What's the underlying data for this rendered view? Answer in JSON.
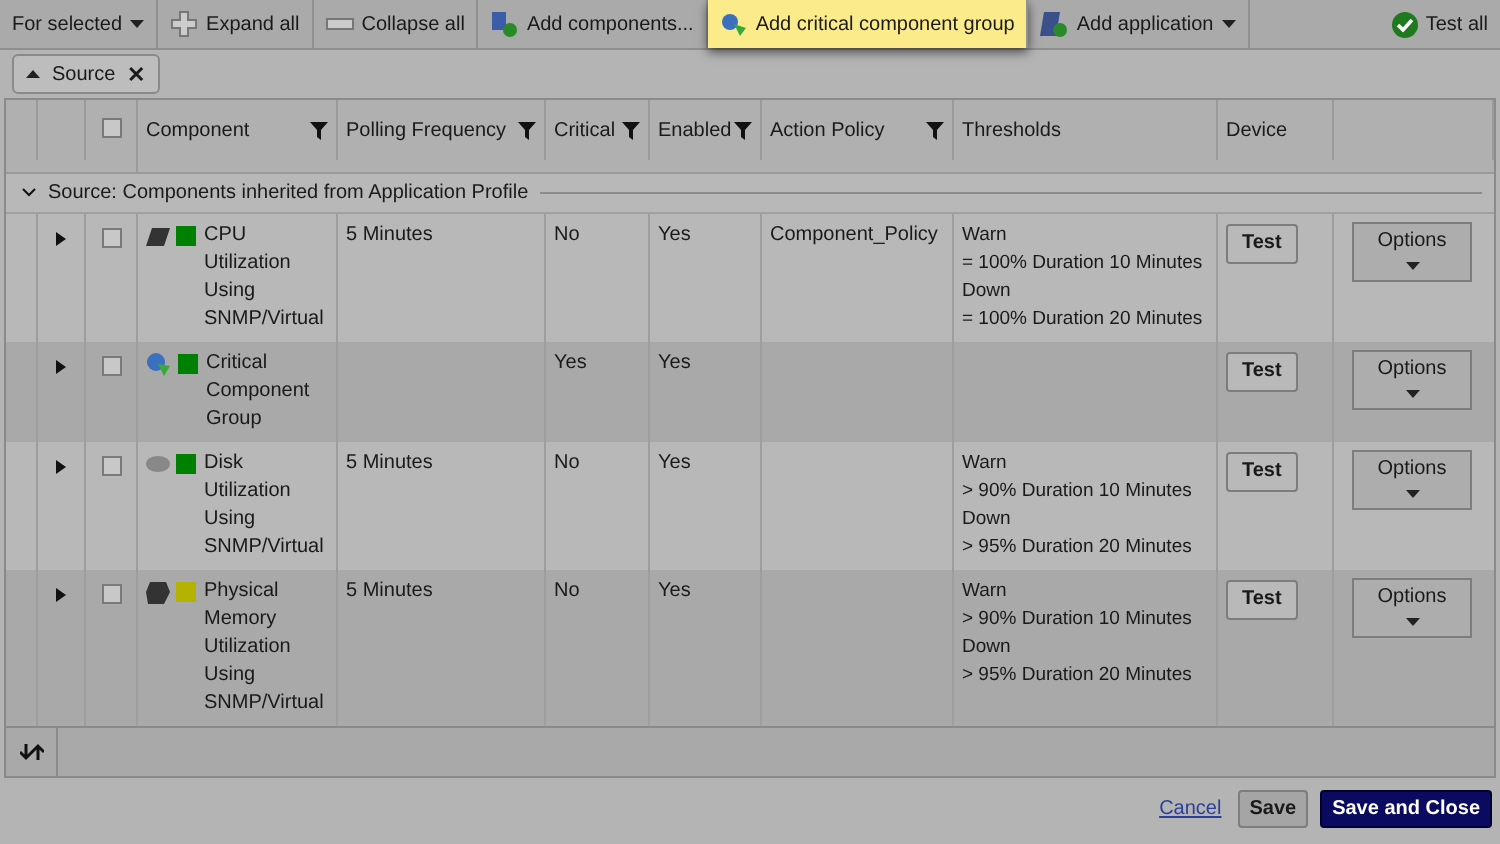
{
  "toolbar": [
    {
      "label": "For selected",
      "kind": "dropdown",
      "highlighted": false
    },
    {
      "label": "Expand all",
      "kind": "expand",
      "highlighted": false
    },
    {
      "label": "Collapse all",
      "kind": "collapse",
      "highlighted": false
    },
    {
      "label": "Add components...",
      "kind": "add",
      "highlighted": false
    },
    {
      "label": "Add critical component group",
      "kind": "group",
      "highlighted": true
    },
    {
      "label": "Add application",
      "kind": "app",
      "highlighted": false
    },
    {
      "label": "Test all",
      "kind": "test",
      "highlighted": false
    }
  ],
  "grouping_chip": {
    "label": "Source",
    "close": "✕"
  },
  "table": {
    "columns": [
      {
        "label": "Component",
        "filter": true
      },
      {
        "label": "Polling Frequency",
        "filter": true
      },
      {
        "label": "Critical",
        "filter": true
      },
      {
        "label": "Enabled",
        "filter": true
      },
      {
        "label": "Action Policy",
        "filter": true
      },
      {
        "label": "Thresholds",
        "filter": false
      },
      {
        "label": "Device",
        "filter": false
      }
    ],
    "select_all_checked": false,
    "group": {
      "label": "Source: Components inherited from Application Profile",
      "expanded": true
    },
    "rows": [
      {
        "kind": "cpu",
        "color": "#008000",
        "component": "CPU Utilization Using SNMP/Virtual",
        "polling": "5 Minutes",
        "critical": "No",
        "enabled": "Yes",
        "policy": "Component_Policy",
        "thresholds": [
          "Warn",
          "= 100% Duration 10 Minutes",
          "Down",
          "= 100% Duration 20 Minutes"
        ],
        "expanded": false,
        "checked": false,
        "test": "Test",
        "options": "Options"
      },
      {
        "kind": "group",
        "color": "#008000",
        "component": "Critical Component Group",
        "polling": "",
        "critical": "Yes",
        "enabled": "Yes",
        "policy": "",
        "thresholds": [],
        "expanded": false,
        "checked": false,
        "test": "Test",
        "options": "Options"
      },
      {
        "kind": "disk",
        "color": "#008000",
        "component": "Disk Utilization Using SNMP/Virtual",
        "polling": "5 Minutes",
        "critical": "No",
        "enabled": "Yes",
        "policy": "",
        "thresholds": [
          "Warn",
          "> 90% Duration 10 Minutes",
          "Down",
          "> 95% Duration 20 Minutes"
        ],
        "expanded": false,
        "checked": false,
        "test": "Test",
        "options": "Options"
      },
      {
        "kind": "memory",
        "color": "#b4b400",
        "component": "Physical Memory Utilization Using SNMP/Virtual",
        "polling": "5 Minutes",
        "critical": "No",
        "enabled": "Yes",
        "policy": "",
        "thresholds": [
          "Warn",
          "> 90% Duration 10 Minutes",
          "Down",
          "> 95% Duration 20 Minutes"
        ],
        "expanded": false,
        "checked": false,
        "test": "Test",
        "options": "Options"
      }
    ]
  },
  "footer": {
    "cancel": "Cancel",
    "save": "Save",
    "save_close": "Save and Close"
  }
}
